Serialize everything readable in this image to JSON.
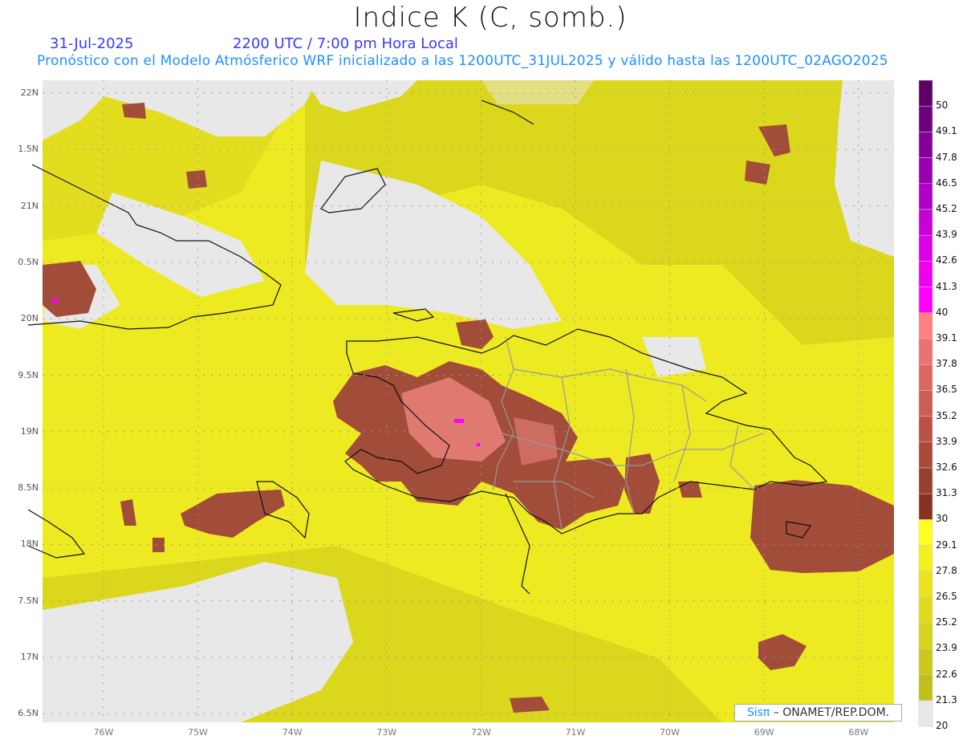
{
  "header": {
    "title": "Indice K (C, somb.)",
    "date": "31-Jul-2025",
    "time": "2200 UTC / 7:00 pm Hora Local",
    "description": "Pronóstico con el Modelo Atmósferico WRF inicializado a las 1200UTC_31JUL2025 y válido hasta las  1200UTC_02AGO2025"
  },
  "map": {
    "lat_labels": [
      "22N",
      "1.5N",
      "21N",
      "0.5N",
      "20N",
      "9.5N",
      "19N",
      "8.5N",
      "18N",
      "7.5N",
      "17N",
      "6.5N"
    ],
    "lon_labels": [
      "76W",
      "75W",
      "74W",
      "73W",
      "72W",
      "71W",
      "70W",
      "69W",
      "68W"
    ],
    "extent": {
      "lon": [
        -76.65,
        -67.6
      ],
      "lat": [
        6.4,
        22.1
      ]
    }
  },
  "legend": {
    "labels": [
      "50",
      "49.1",
      "47.8",
      "46.5",
      "45.2",
      "43.9",
      "42.6",
      "41.3",
      "40",
      "39.1",
      "37.8",
      "36.5",
      "35.2",
      "33.9",
      "32.6",
      "31.3",
      "30",
      "29.1",
      "27.8",
      "26.5",
      "25.2",
      "23.9",
      "22.6",
      "21.3",
      "20"
    ],
    "colors": [
      "#5e0066",
      "#6e0080",
      "#830097",
      "#9800b0",
      "#b000c8",
      "#c800d8",
      "#dd00e6",
      "#f000f0",
      "#ff00ff",
      "#ff8080",
      "#ee7070",
      "#de6660",
      "#cd5c52",
      "#bb5245",
      "#aa4839",
      "#983f2e",
      "#853222",
      "#ffff20",
      "#f4f020",
      "#eae31e",
      "#e0dc1c",
      "#d6d41c",
      "#ccc81c",
      "#c0c01c",
      "#e8e8e8"
    ]
  },
  "credit": {
    "brand": "Sisπ",
    "text": " –  ONAMET/REP.DOM."
  }
}
